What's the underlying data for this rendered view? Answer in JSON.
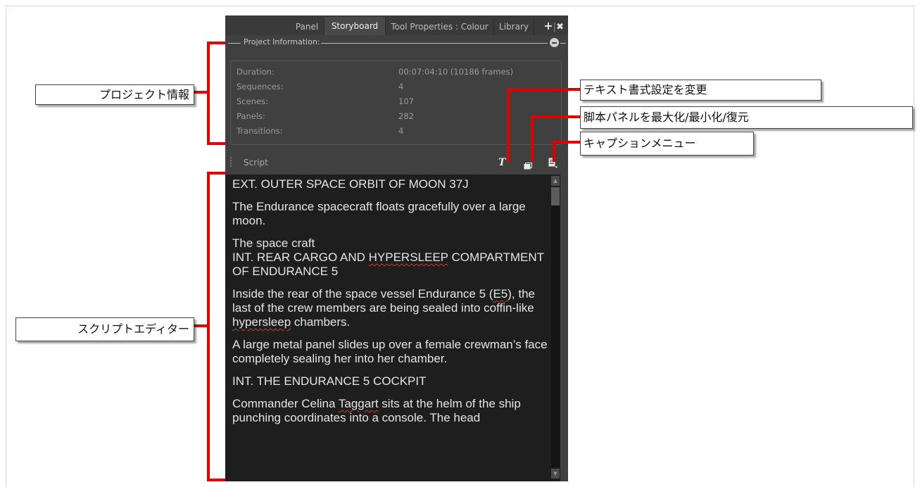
{
  "tabs": [
    "Panel",
    "Storyboard",
    "Tool Properties : Colour",
    "Library"
  ],
  "active_tab": "Storyboard",
  "tab_actions": {
    "add": "+",
    "separator": "|",
    "close": "✖"
  },
  "project_info": {
    "header": "Project Information:",
    "rows": [
      {
        "label": "Duration:",
        "value": "00:07:04:10  (10186 frames)"
      },
      {
        "label": "Sequences:",
        "value": "4"
      },
      {
        "label": "Scenes:",
        "value": "107"
      },
      {
        "label": "Panels:",
        "value": "282"
      },
      {
        "label": "Transitions:",
        "value": "4"
      }
    ]
  },
  "script": {
    "label": "Script",
    "icons": [
      "text-format-icon",
      "maximize-restore-icon",
      "caption-menu-icon"
    ],
    "paragraphs": [
      "EXT. OUTER SPACE ORBIT OF MOON 37J",
      "The Endurance spacecraft floats gracefully over a large moon.",
      "The space craft\nINT. REAR CARGO AND HYPERSLEEP COMPARTMENT OF ENDURANCE 5",
      "Inside the rear of the space vessel Endurance 5 (E5), the last of the crew members are being sealed into coffin-like hypersleep chambers.",
      "A large metal panel slides up over a female crewman’s face completely sealing her into her chamber.",
      "INT. THE ENDURANCE 5 COCKPIT",
      "Commander Celina Taggart sits at the helm of the ship punching coordinates into a console. The head"
    ]
  },
  "annotations": {
    "project_info": "プロジェクト情報",
    "script_editor": "スクリプトエディター",
    "text_format": "テキスト書式設定を変更",
    "maximize": "脚本パネルを最大化/最小化/復元",
    "caption_menu": "キャプションメニュー"
  },
  "colors": {
    "panel_bg": "#404040",
    "editor_bg": "#1e1e1e",
    "annotation": "#e00000"
  }
}
